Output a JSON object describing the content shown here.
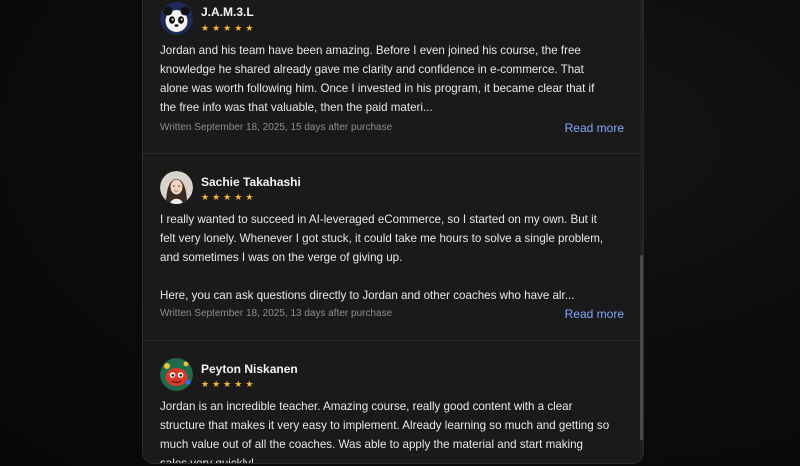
{
  "reviews": [
    {
      "name": "J.A.M.3.L",
      "rating": 5,
      "avatar_icon": "panda-avatar-icon",
      "text": "Jordan and his team have been amazing. Before I even joined his course, the free\nknowledge he shared already gave me clarity and confidence in e-commerce. That\nalone was worth following him. Once I invested in his program, it became clear that if\nthe free info was that valuable, then the paid materi...",
      "meta": "Written September 18, 2025, 15 days after purchase",
      "read_more": "Read more"
    },
    {
      "name": "Sachie Takahashi",
      "rating": 5,
      "avatar_icon": "person-photo-avatar-icon",
      "text": "I really wanted to succeed in AI-leveraged eCommerce, so I started on my own. But it\nfelt very lonely. Whenever I got stuck, it could take me hours to solve a single problem,\nand sometimes I was on the verge of giving up.\n\nHere, you can ask questions directly to Jordan and other coaches who have alr...",
      "meta": "Written September 18, 2025, 13 days after purchase",
      "read_more": "Read more"
    },
    {
      "name": "Peyton Niskanen",
      "rating": 5,
      "avatar_icon": "cartoon-avatar-icon",
      "text": "Jordan is an incredible teacher. Amazing course, really good content with a clear\nstructure that makes it very easy to implement. Already learning so much and getting so\nmuch value out of all the coaches. Was able to apply the material and start making\nsales very quickly!",
      "meta": "",
      "read_more": ""
    }
  ],
  "colors": {
    "star": "#f5b731",
    "link": "#7fa8ff",
    "panel_bg": "#1a1a1b"
  }
}
